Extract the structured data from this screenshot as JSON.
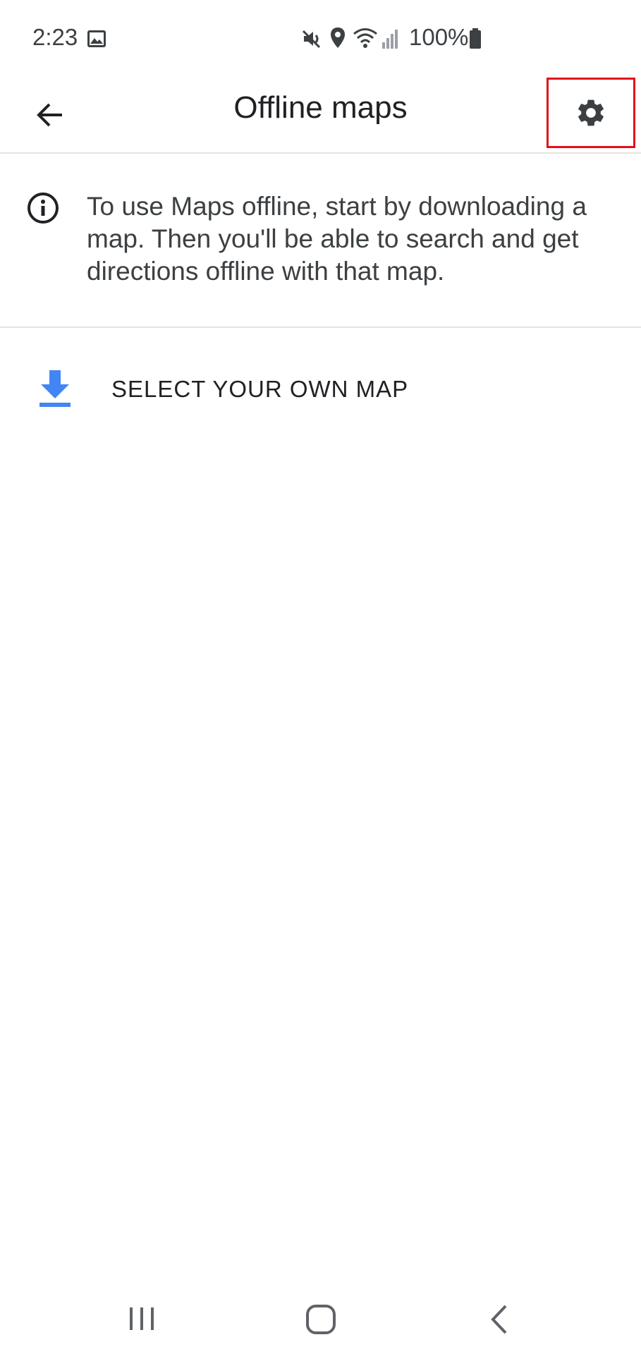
{
  "status_bar": {
    "time": "2:23",
    "battery": "100%",
    "icons": [
      "gallery-icon",
      "mute-icon",
      "location-icon",
      "wifi-icon",
      "signal-icon",
      "battery-icon"
    ]
  },
  "app_bar": {
    "title": "Offline maps",
    "back_icon": "arrow-back-icon",
    "settings_icon": "gear-icon",
    "highlight_color": "#e3101c"
  },
  "info": {
    "text": "To use Maps offline, start by downloading a map. Then you'll be able to search and get directions offline with that map.",
    "icon": "info-icon"
  },
  "select_map": {
    "label": "SELECT YOUR OWN MAP",
    "icon": "download-icon",
    "accent_color": "#4285f4"
  },
  "nav_bar": {
    "icons": [
      "recent-apps-icon",
      "home-icon",
      "back-nav-icon"
    ]
  }
}
